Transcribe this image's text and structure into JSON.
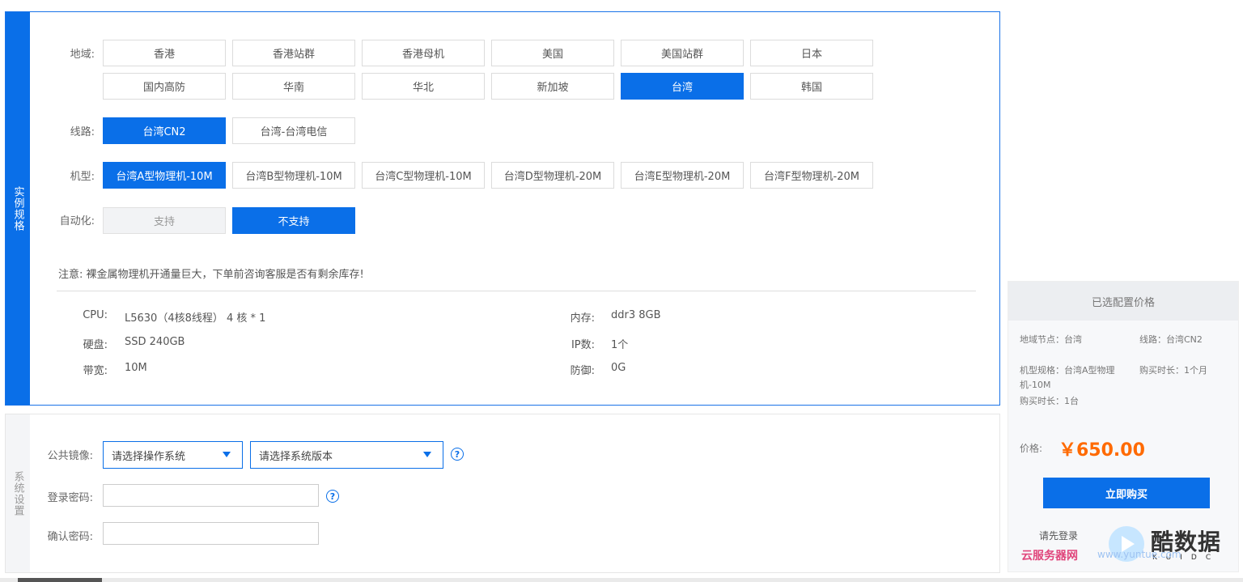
{
  "spec_panel": {
    "side_label": "实例规格",
    "region": {
      "label": "地域:",
      "options": [
        "香港",
        "香港站群",
        "香港母机",
        "美国",
        "美国站群",
        "日本",
        "国内高防",
        "华南",
        "华北",
        "新加坡",
        "台湾",
        "韩国"
      ],
      "selected": "台湾"
    },
    "line": {
      "label": "线路:",
      "options": [
        "台湾CN2",
        "台湾-台湾电信"
      ],
      "selected": "台湾CN2"
    },
    "model": {
      "label": "机型:",
      "options": [
        "台湾A型物理机-10M",
        "台湾B型物理机-10M",
        "台湾C型物理机-10M",
        "台湾D型物理机-20M",
        "台湾E型物理机-20M",
        "台湾F型物理机-20M"
      ],
      "selected": "台湾A型物理机-10M"
    },
    "automation": {
      "label": "自动化:",
      "options": [
        "支持",
        "不支持"
      ],
      "selected": "不支持"
    },
    "notice": "注意:  裸金属物理机开通量巨大，下单前咨询客服是否有剩余库存!",
    "specs": {
      "cpu_label": "CPU:",
      "cpu_value": "L5630（4核8线程）   4 核  *  1",
      "mem_label": "内存:",
      "mem_value": "ddr3 8GB",
      "disk_label": "硬盘:",
      "disk_value": "SSD 240GB",
      "ip_label": "IP数:",
      "ip_value": "1个",
      "bw_label": "带宽:",
      "bw_value": "10M",
      "def_label": "防御:",
      "def_value": "0G"
    }
  },
  "sys_panel": {
    "side_label": "系统设置",
    "image_label": "公共镜像:",
    "os_select": "请选择操作系统",
    "version_select": "请选择系统版本",
    "password_label": "登录密码:",
    "confirm_label": "确认密码:",
    "help_glyph": "?"
  },
  "price_panel": {
    "title": "已选配置价格",
    "region_node": "地域节点：台湾",
    "line": "线路：台湾CN2",
    "model": "机型规格：台湾A型物理机-10M",
    "duration": "购买时长：1个月",
    "quantity": "购买时长：1台",
    "price_label": "价格:",
    "price_value": "￥650.00",
    "buy_button": "立即购买",
    "login_link": "请先登录"
  },
  "watermark": {
    "brand": "酷数据",
    "sub": "KUIDC",
    "pink_text": "云服务器网",
    "url": "www.yuntue.com"
  },
  "colors": {
    "accent": "#0a6fe8",
    "price": "#ff6a00"
  }
}
